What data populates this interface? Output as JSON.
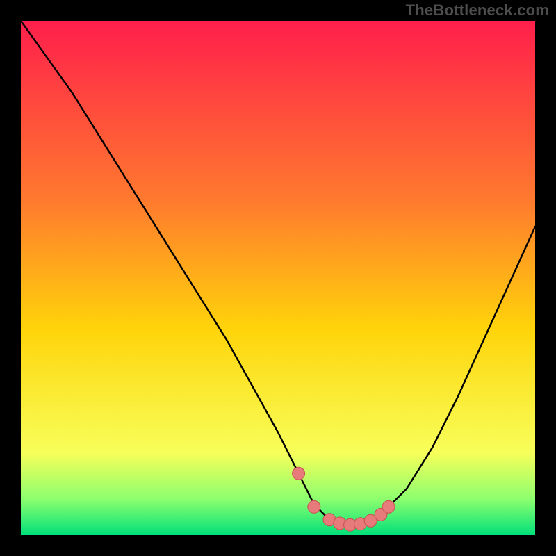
{
  "watermark": "TheBottleneck.com",
  "colors": {
    "background": "#000000",
    "gradient_top": "#ff1f4b",
    "gradient_mid_high": "#ff7a2e",
    "gradient_mid": "#ffd40a",
    "gradient_low": "#f7ff5a",
    "gradient_bottom_band": "#8cff6e",
    "gradient_bottom": "#00e07a",
    "curve_stroke": "#000000",
    "marker_fill": "#e77a7a",
    "marker_stroke": "#c84f4f"
  },
  "chart_data": {
    "type": "line",
    "title": "",
    "xlabel": "",
    "ylabel": "",
    "xlim": [
      0,
      100
    ],
    "ylim": [
      0,
      100
    ],
    "series": [
      {
        "name": "bottleneck-curve",
        "x": [
          0,
          5,
          10,
          15,
          20,
          25,
          30,
          35,
          40,
          45,
          50,
          54,
          57,
          60,
          64,
          67,
          70,
          75,
          80,
          85,
          90,
          95,
          100
        ],
        "y": [
          100,
          93,
          86,
          78,
          70,
          62,
          54,
          46,
          38,
          29,
          20,
          12,
          6,
          3,
          2,
          2.5,
          4,
          9,
          17,
          27,
          38,
          49,
          60
        ]
      }
    ],
    "markers": {
      "name": "highlight-points",
      "x": [
        54,
        57,
        60,
        62,
        64,
        66,
        68,
        70,
        71.5
      ],
      "y": [
        12,
        5.5,
        3,
        2.3,
        2,
        2.2,
        2.8,
        4,
        5.5
      ]
    }
  }
}
